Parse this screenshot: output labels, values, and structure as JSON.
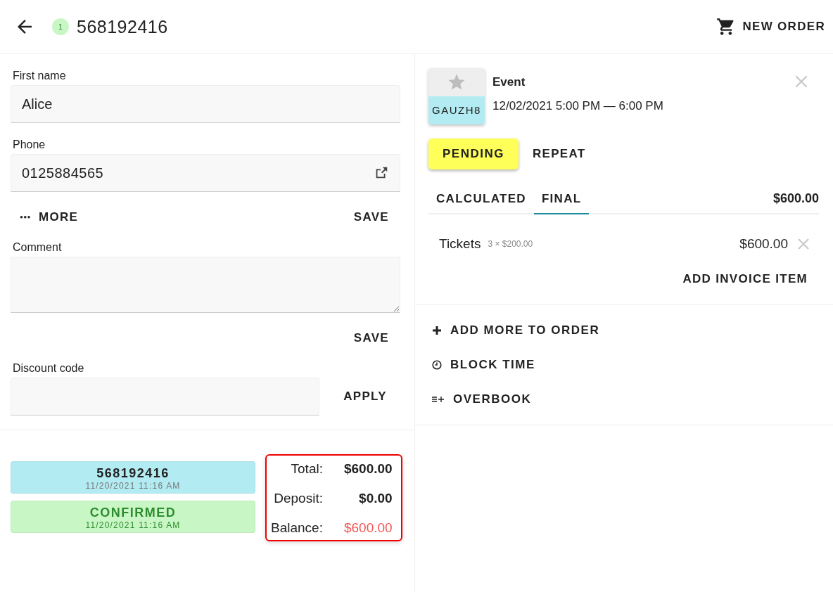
{
  "header": {
    "badge": "1",
    "title": "568192416",
    "new_order": "NEW ORDER"
  },
  "form": {
    "first_name": {
      "label": "First name",
      "value": "Alice"
    },
    "phone": {
      "label": "Phone",
      "value": "0125884565"
    },
    "more": "MORE",
    "save_contact": "SAVE",
    "comment": {
      "label": "Comment"
    },
    "save_comment": "SAVE",
    "discount": {
      "label": "Discount code"
    },
    "apply": "APPLY"
  },
  "statuses": [
    {
      "title": "568192416",
      "time": "11/20/2021 11:16 AM",
      "color": "#b2ebf2"
    },
    {
      "title": "CONFIRMED",
      "time": "11/20/2021 11:16 AM",
      "color": "#c8f7c5"
    }
  ],
  "totals": [
    {
      "label": "Total:",
      "value": "$600.00",
      "kind": "normal"
    },
    {
      "label": "Deposit:",
      "value": "$0.00",
      "kind": "normal"
    },
    {
      "label": "Balance:",
      "value": "$600.00",
      "kind": "due"
    }
  ],
  "event": {
    "code": "GAUZH8",
    "title": "Event",
    "time": "12/02/2021 5:00 PM — 6:00 PM",
    "status": "PENDING",
    "repeat": "REPEAT"
  },
  "tabs": [
    {
      "label": "CALCULATED",
      "selected": false
    },
    {
      "label": "FINAL",
      "selected": true
    }
  ],
  "tab_total": "$600.00",
  "invoice_items": [
    {
      "name": "Tickets",
      "detail": "3 × $200.00",
      "amount": "$600.00"
    }
  ],
  "add_invoice_item": "ADD INVOICE ITEM",
  "actions": [
    {
      "label": "ADD MORE TO ORDER",
      "kind": "plus"
    },
    {
      "label": "BLOCK TIME",
      "kind": "clock"
    },
    {
      "label": "OVERBOOK",
      "kind": "overbook"
    }
  ]
}
